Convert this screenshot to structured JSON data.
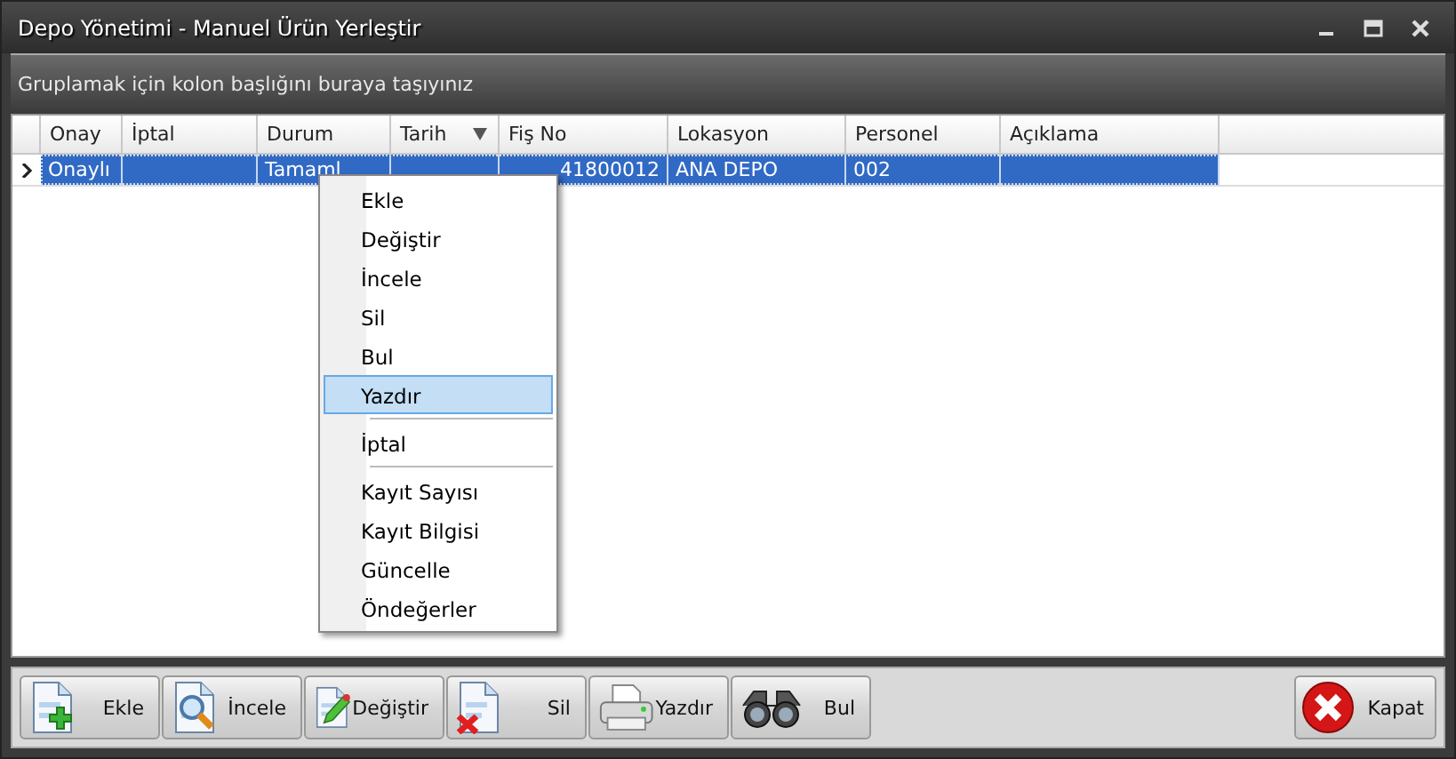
{
  "window": {
    "title": "Depo Yönetimi - Manuel Ürün Yerleştir"
  },
  "group_panel": {
    "hint": "Gruplamak için kolon başlığını buraya taşıyınız"
  },
  "table": {
    "columns": [
      {
        "label": "Onay",
        "sorted": false
      },
      {
        "label": "İptal",
        "sorted": false
      },
      {
        "label": "Durum",
        "sorted": false
      },
      {
        "label": "Tarih",
        "sorted": true
      },
      {
        "label": "Fiş No",
        "sorted": false
      },
      {
        "label": "Lokasyon",
        "sorted": false
      },
      {
        "label": "Personel",
        "sorted": false
      },
      {
        "label": "Açıklama",
        "sorted": false
      }
    ],
    "rows": [
      {
        "selected": true,
        "cells": [
          "Onaylı",
          "",
          "Tamaml",
          "",
          "41800012",
          "ANA DEPO",
          "002",
          ""
        ]
      }
    ]
  },
  "context_menu": {
    "groups": [
      [
        {
          "label": "Ekle",
          "selected": false
        },
        {
          "label": "Değiştir",
          "selected": false
        },
        {
          "label": "İncele",
          "selected": false
        },
        {
          "label": "Sil",
          "selected": false
        },
        {
          "label": "Bul",
          "selected": false
        },
        {
          "label": "Yazdır",
          "selected": true
        }
      ],
      [
        {
          "label": "İptal",
          "selected": false
        }
      ],
      [
        {
          "label": "Kayıt Sayısı",
          "selected": false
        },
        {
          "label": "Kayıt Bilgisi",
          "selected": false
        },
        {
          "label": "Güncelle",
          "selected": false
        },
        {
          "label": "Öndeğerler",
          "selected": false
        }
      ]
    ]
  },
  "toolbar": {
    "buttons": [
      {
        "label": "Ekle",
        "kind": "add"
      },
      {
        "label": "İncele",
        "kind": "view"
      },
      {
        "label": "Değiştir",
        "kind": "edit"
      },
      {
        "label": "Sil",
        "kind": "delete"
      },
      {
        "label": "Yazdır",
        "kind": "print"
      },
      {
        "label": "Bul",
        "kind": "find"
      }
    ],
    "close_button": {
      "label": "Kapat"
    }
  }
}
